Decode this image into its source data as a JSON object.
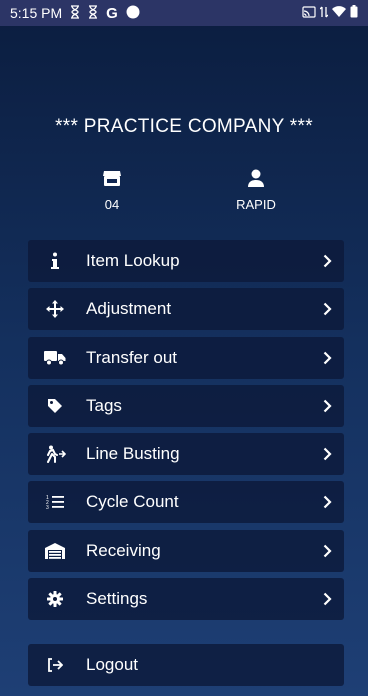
{
  "status_bar": {
    "time": "5:15 PM",
    "left_icons": [
      "hourglass-icon",
      "hourglass-icon",
      "google-icon",
      "circle-icon"
    ],
    "right_icons": [
      "cast-icon",
      "data-icon",
      "wifi-icon",
      "battery-icon"
    ]
  },
  "header": {
    "company": "*** PRACTICE COMPANY ***",
    "store_number": "04",
    "user_name": "RAPID"
  },
  "menu": {
    "items": [
      {
        "label": "Item Lookup",
        "icon": "info-icon"
      },
      {
        "label": "Adjustment",
        "icon": "move-arrows-icon"
      },
      {
        "label": "Transfer out",
        "icon": "truck-icon"
      },
      {
        "label": "Tags",
        "icon": "tag-icon"
      },
      {
        "label": "Line Busting",
        "icon": "walking-person-icon"
      },
      {
        "label": "Cycle Count",
        "icon": "numbered-list-icon"
      },
      {
        "label": "Receiving",
        "icon": "warehouse-icon"
      },
      {
        "label": "Settings",
        "icon": "gear-icon"
      }
    ],
    "logout_label": "Logout"
  },
  "colors": {
    "background_top": "#0b1d3f",
    "background_bottom": "#1e3f75",
    "status_bar": "#2c3566",
    "menu_item": "#0c1a3a",
    "text": "#ffffff"
  }
}
